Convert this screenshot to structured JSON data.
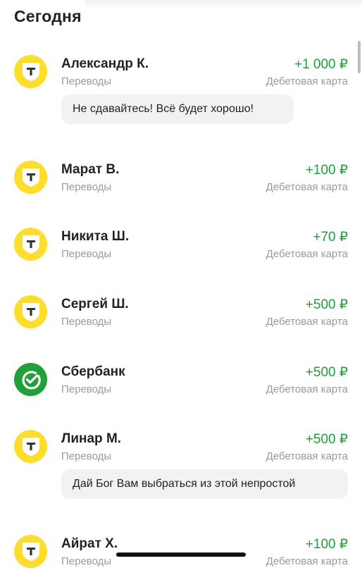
{
  "section": {
    "title": "Сегодня"
  },
  "transactions": [
    {
      "name": "Александр К.",
      "category": "Переводы",
      "amount": "+1 000 ₽",
      "account": "Дебетовая карта",
      "message": "Не сдавайтесь! Всё будет хорошо!",
      "logo": "tbank-shield-icon"
    },
    {
      "name": "Марат В.",
      "category": "Переводы",
      "amount": "+100 ₽",
      "account": "Дебетовая карта",
      "logo": "tbank-shield-icon"
    },
    {
      "name": "Никита Ш.",
      "category": "Переводы",
      "amount": "+70 ₽",
      "account": "Дебетовая карта",
      "logo": "tbank-shield-icon"
    },
    {
      "name": "Сергей Ш.",
      "category": "Переводы",
      "amount": "+500 ₽",
      "account": "Дебетовая карта",
      "logo": "tbank-shield-icon"
    },
    {
      "name": "Сбербанк",
      "category": "Переводы",
      "amount": "+500 ₽",
      "account": "Дебетовая карта",
      "logo": "sber-check-icon"
    },
    {
      "name": "Линар М.",
      "category": "Переводы",
      "amount": "+500 ₽",
      "account": "Дебетовая карта",
      "message": "Дай Бог Вам выбраться из этой непростой",
      "logo": "tbank-shield-icon"
    },
    {
      "name": "Айрат Х.",
      "category": "Переводы",
      "amount": "+100 ₽",
      "account": "Дебетовая карта",
      "logo": "tbank-shield-icon"
    }
  ],
  "colors": {
    "income": "#1f9d3a",
    "tbank_yellow": "#ffdd2d",
    "sber_green": "#21a038",
    "secondary_text": "#9a9a9a"
  }
}
